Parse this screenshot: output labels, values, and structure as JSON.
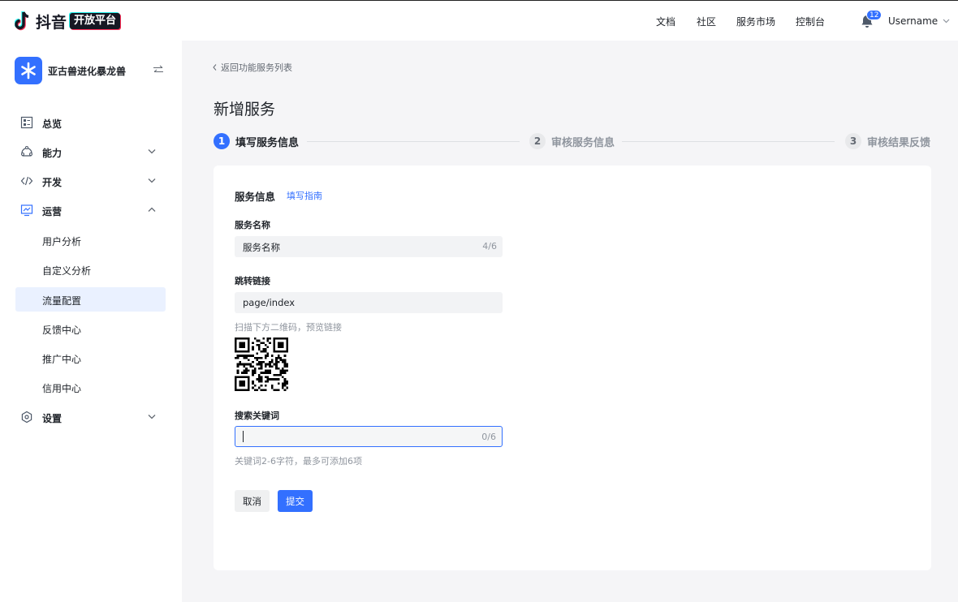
{
  "header": {
    "logo_text": "抖音",
    "logo_badge": "开放平台",
    "nav": [
      "文档",
      "社区",
      "服务市场",
      "控制台"
    ],
    "notification_count": "12",
    "username": "Username"
  },
  "sidebar": {
    "app_name": "亚古兽进化暴龙兽",
    "items": [
      {
        "label": "总览",
        "icon": "dashboard-icon"
      },
      {
        "label": "能力",
        "icon": "capability-icon"
      },
      {
        "label": "开发",
        "icon": "code-icon"
      },
      {
        "label": "运营",
        "icon": "operations-icon"
      },
      {
        "label": "设置",
        "icon": "settings-icon"
      }
    ],
    "sub_items": [
      "用户分析",
      "自定义分析",
      "流量配置",
      "反馈中心",
      "推广中心",
      "信用中心"
    ],
    "active_sub_item": "流量配置"
  },
  "main": {
    "back_link": "返回功能服务列表",
    "title": "新增服务",
    "steps": [
      {
        "num": "1",
        "label": "填写服务信息"
      },
      {
        "num": "2",
        "label": "审核服务信息"
      },
      {
        "num": "3",
        "label": "审核结果反馈"
      }
    ],
    "form": {
      "section_title": "服务信息",
      "guide_link": "填写指南",
      "name_label": "服务名称",
      "name_value": "服务名称",
      "name_count": "4/6",
      "link_label": "跳转链接",
      "link_value": "page/index",
      "qr_hint": "扫描下方二维码，预览链接",
      "keyword_label": "搜索关键词",
      "keyword_count": "0/6",
      "keyword_hint": "关键词2-6字符，最多可添加6项",
      "cancel_label": "取消",
      "submit_label": "提交"
    }
  },
  "colors": {
    "accent": "#3370ff",
    "active_bg": "#eaf1ff"
  }
}
